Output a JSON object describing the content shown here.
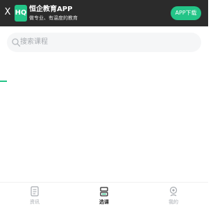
{
  "banner": {
    "close_label": "X",
    "logo_text": "HQ",
    "app_name": "恒企教育APP",
    "slogan": "做专业、有温度的教育",
    "download_label": "APP下载"
  },
  "search": {
    "placeholder": "搜索课程"
  },
  "bottom_nav": {
    "items": [
      {
        "label": "资讯",
        "icon": "news-icon",
        "active": false
      },
      {
        "label": "选课",
        "icon": "course-icon",
        "active": true
      },
      {
        "label": "我的",
        "icon": "profile-icon",
        "active": false
      }
    ]
  },
  "colors": {
    "accent": "#23c487",
    "banner_bg": "#2b2b2b",
    "muted_text": "#a7abb0",
    "active_text": "#2b2b2b"
  }
}
